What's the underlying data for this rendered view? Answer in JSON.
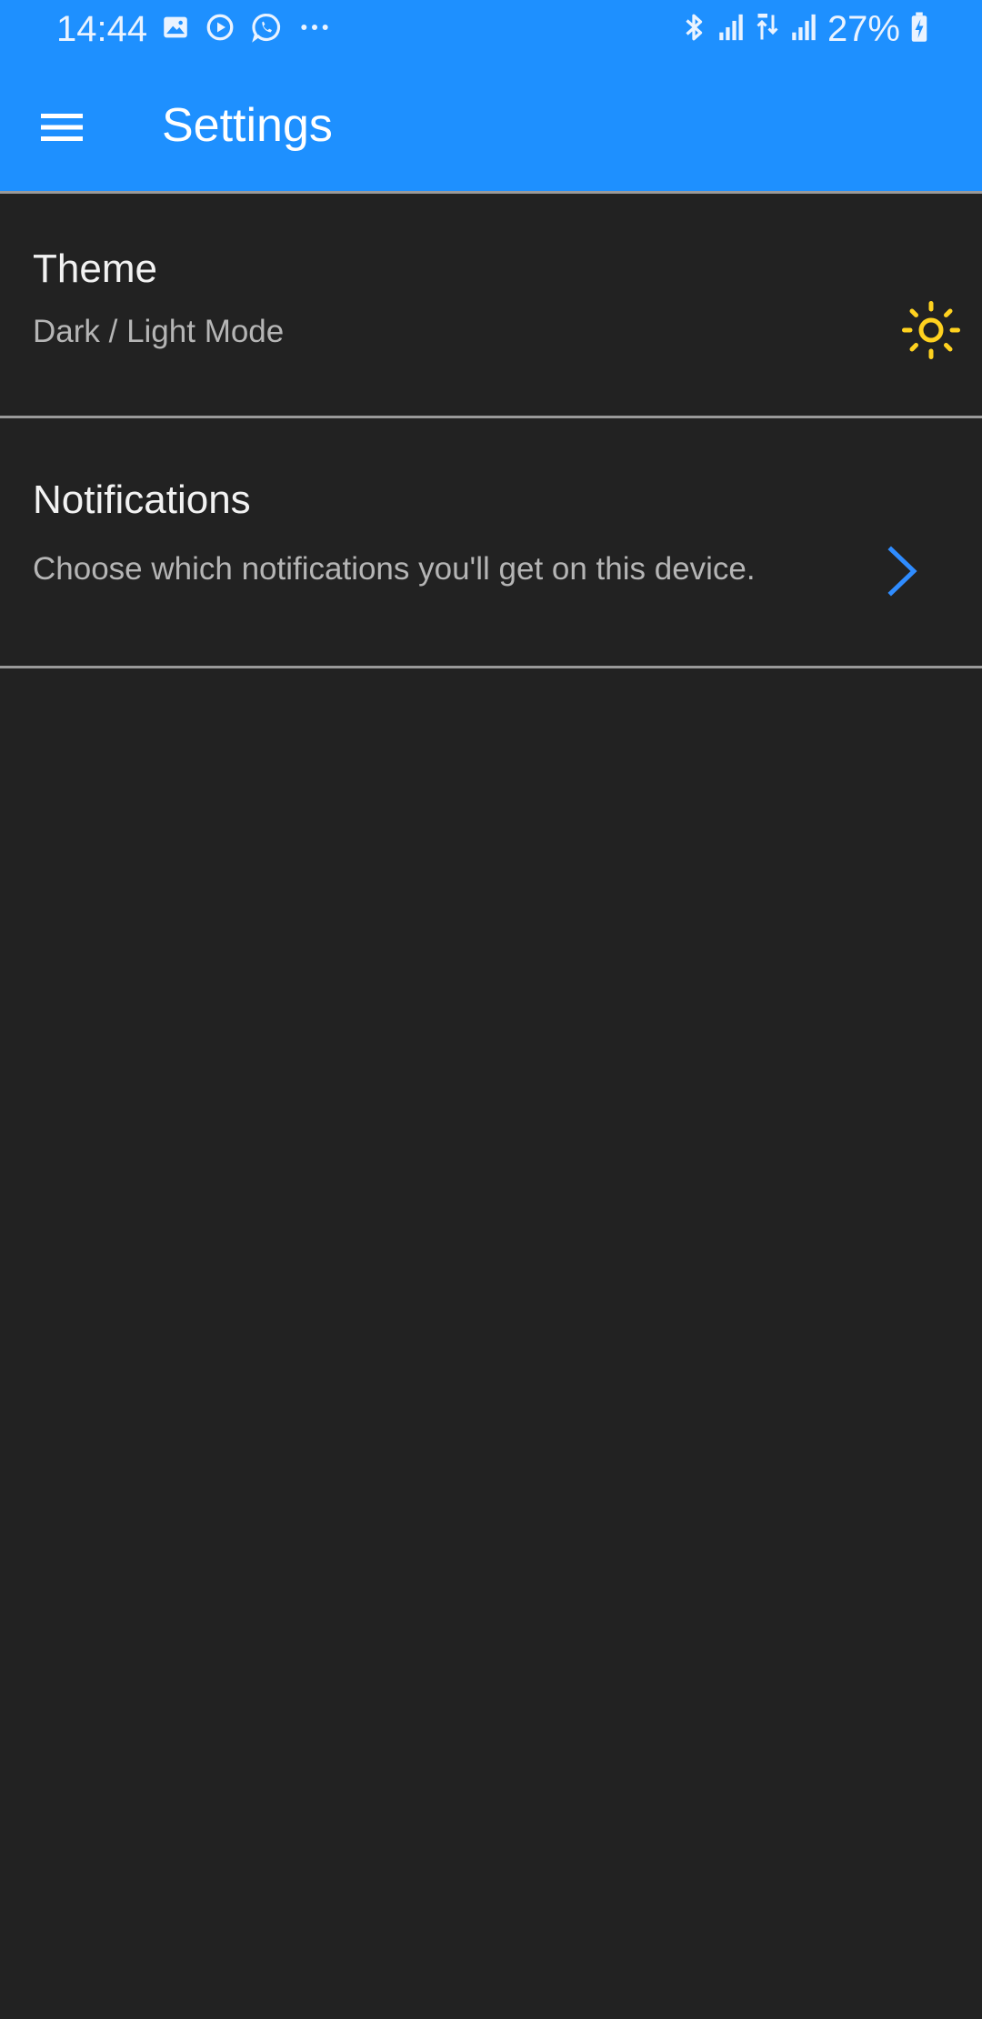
{
  "status_bar": {
    "time": "14:44",
    "battery": "27%",
    "left_icons": [
      "image-icon",
      "play-circle-icon",
      "whatsapp-icon",
      "more-dots-icon"
    ],
    "right_icons": [
      "bluetooth-icon",
      "signal-icon",
      "data-arrows-icon",
      "signal-icon",
      "battery-charging-icon"
    ]
  },
  "app_bar": {
    "title": "Settings",
    "menu_icon": "hamburger-menu-icon",
    "color": "#1e90ff"
  },
  "settings": {
    "items": [
      {
        "title": "Theme",
        "subtitle": "Dark / Light Mode",
        "icon": "sun-icon",
        "icon_color": "#ffd21f"
      },
      {
        "title": "Notifications",
        "subtitle": "Choose which notifications you'll get on this device.",
        "icon": "chevron-right-icon",
        "icon_color": "#2f8cff"
      }
    ]
  },
  "colors": {
    "background": "#222222",
    "divider": "#9a9a9a",
    "title_text": "#f2f2f2",
    "subtitle_text": "#b5b5b5"
  }
}
